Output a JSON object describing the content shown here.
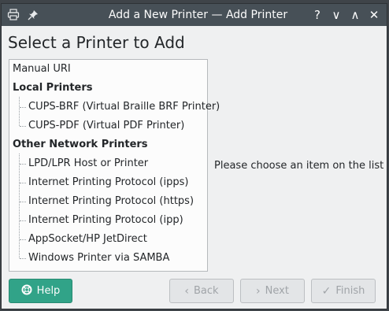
{
  "window": {
    "title": "Add a New Printer — Add Printer",
    "help_glyph": "?",
    "minimize_glyph": "∨",
    "maximize_glyph": "∧",
    "close_glyph": "✕"
  },
  "page": {
    "heading": "Select a Printer to Add",
    "hint": "Please choose an item on the list"
  },
  "tree": {
    "manual": "Manual URI",
    "local_header": "Local Printers",
    "local_items": [
      "CUPS-BRF (Virtual Braille BRF Printer)",
      "CUPS-PDF (Virtual PDF Printer)"
    ],
    "network_header": "Other Network Printers",
    "network_items": [
      "LPD/LPR Host or Printer",
      "Internet Printing Protocol (ipps)",
      "Internet Printing Protocol (https)",
      "Internet Printing Protocol (ipp)",
      "AppSocket/HP JetDirect",
      "Windows Printer via SAMBA"
    ]
  },
  "buttons": {
    "help": "Help",
    "back": "Back",
    "next": "Next",
    "finish": "Finish"
  },
  "colors": {
    "titlebar": "#475057",
    "help_button": "#31a388",
    "window_bg": "#eff0f1"
  }
}
